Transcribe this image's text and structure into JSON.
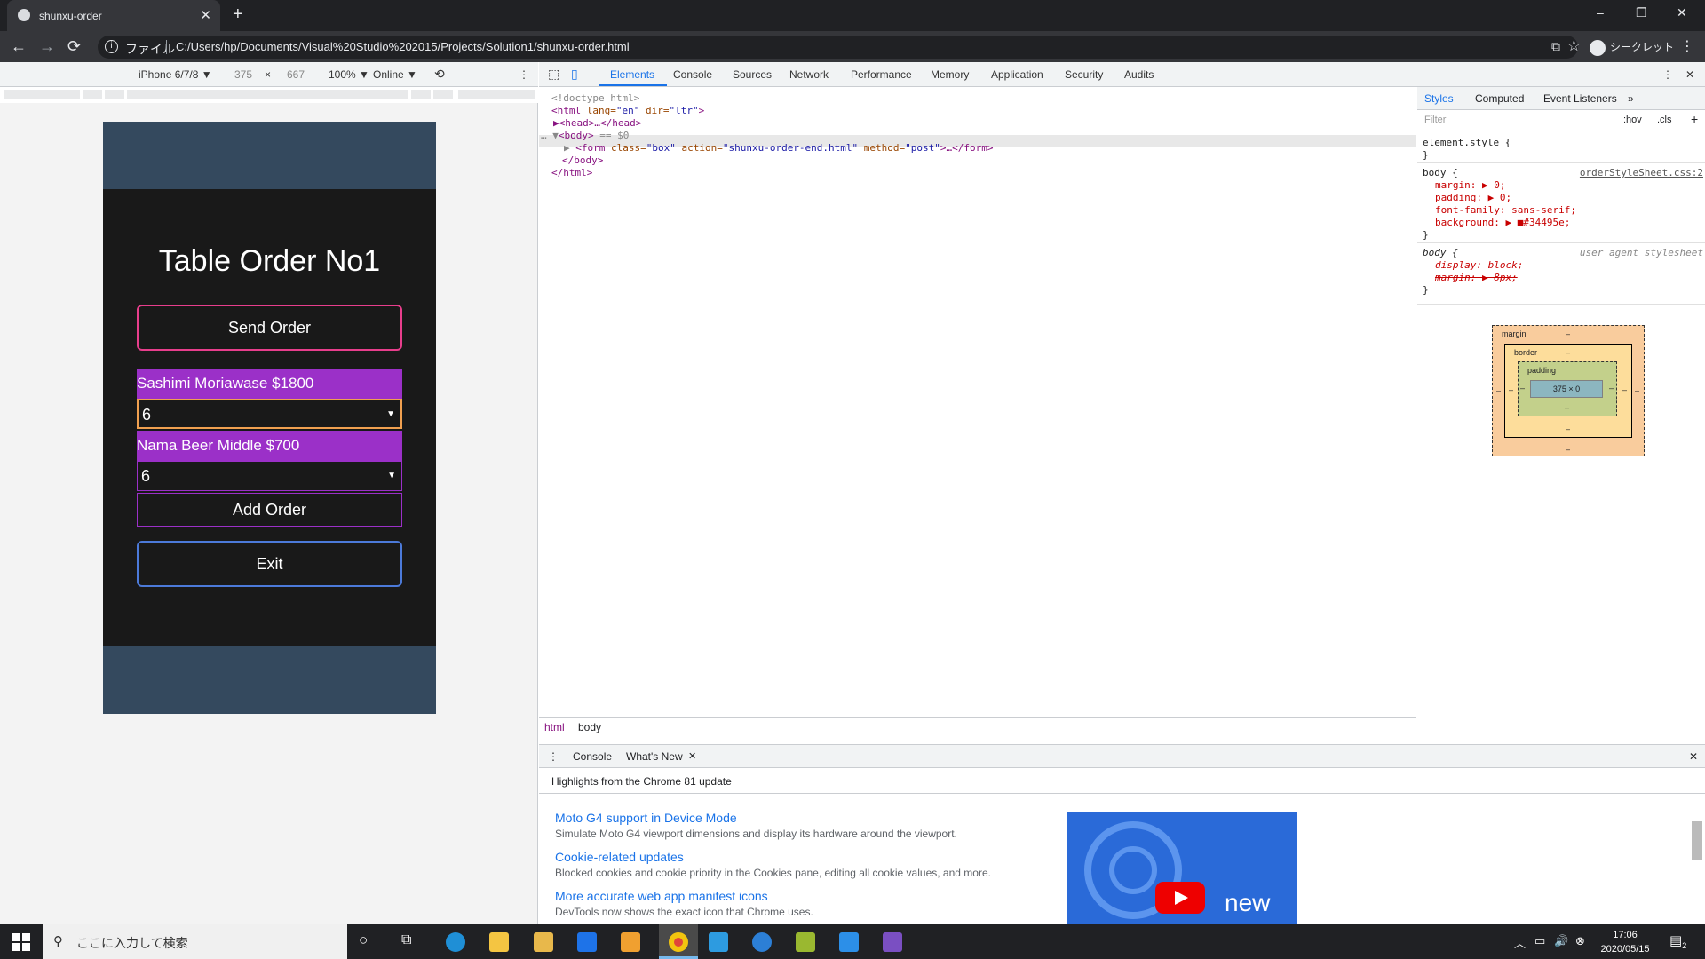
{
  "browser": {
    "tab_title": "shunxu-order",
    "new_tab": "+",
    "minimize": "–",
    "restore": "❐",
    "close": "✕",
    "back": "←",
    "forward": "→",
    "reload": "⟳",
    "info": "i",
    "file_label": "ファイル",
    "url": "C:/Users/hp/Documents/Visual%20Studio%202015/Projects/Solution1/shunxu-order.html",
    "translate": "⧉",
    "star": "☆",
    "incognito": "シークレット",
    "menu": "⋮"
  },
  "device_toolbar": {
    "device": "iPhone 6/7/8 ▼",
    "width": "375",
    "times": "×",
    "height": "667",
    "zoom": "100% ▼",
    "throttle": "Online ▼",
    "rotate": "⟲",
    "more": "⋮"
  },
  "page": {
    "title": "Table Order No1",
    "send_order": "Send Order",
    "item1_label": "Sashimi Moriawase $1800",
    "item1_qty": "6",
    "item2_label": "Nama Beer Middle $700",
    "item2_qty": "6",
    "add_order": "Add Order",
    "exit": "Exit",
    "arrow": "▼",
    "colors": {
      "background": "#34495e",
      "form": "#191919",
      "item": "#9b30c8",
      "send_border": "#e83e8c",
      "exit_border": "#4c7ad9"
    }
  },
  "devtools": {
    "inspect": "⬚",
    "device": "▯",
    "tabs": [
      "Elements",
      "Console",
      "Sources",
      "Network",
      "Performance",
      "Memory",
      "Application",
      "Security",
      "Audits"
    ],
    "kebab": "⋮",
    "close": "✕",
    "dom": {
      "doctype": "<!doctype html>",
      "html_open_tag": "<html",
      "lang_attr": " lang=",
      "lang_val": "\"en\"",
      "dir_attr": " dir=",
      "dir_val": "\"ltr\"",
      "gt": ">",
      "head": "▶<head>…</head>",
      "body_dots": "… ▼",
      "body_tag": "<body>",
      "body_eq": " == $0",
      "form_tri": "▶",
      "form_open": "<form",
      "class_attr": " class=",
      "class_val": "\"box\"",
      "action_attr": " action=",
      "action_val": "\"shunxu-order-end.html\"",
      "method_attr": " method=",
      "method_val": "\"post\"",
      "form_end": ">…</form>",
      "body_close": "</body>",
      "html_close": "</html>"
    },
    "breadcrumb": [
      "html",
      "body"
    ],
    "side_tabs": [
      "Styles",
      "Computed",
      "Event Listeners",
      "»"
    ],
    "filter_placeholder": "Filter",
    "hov": ":hov",
    "cls": ".cls",
    "plus": "+",
    "styles": {
      "element_style": "element.style {",
      "close_brace": "}",
      "body_rule": "body {",
      "body_source": "orderStyleSheet.css:2",
      "margin": "margin: ▶ 0;",
      "padding": "padding: ▶ 0;",
      "font_family": "font-family: sans-serif;",
      "background": "background: ▶ ■#34495e;",
      "ua_rule": "body {",
      "ua_source": "user agent stylesheet",
      "display": "display: block;",
      "margin_struck": "margin: ▶ 8px;"
    },
    "boxmodel": {
      "margin": "margin",
      "border": "border",
      "padding": "padding",
      "content": "375 × 0",
      "dash": "–"
    }
  },
  "drawer": {
    "kebab": "⋮",
    "tabs": [
      "Console",
      "What's New"
    ],
    "tab_close": "✕",
    "close": "✕",
    "highlight": "Highlights from the Chrome 81 update",
    "features": [
      {
        "title": "Moto G4 support in Device Mode",
        "desc": "Simulate Moto G4 viewport dimensions and display its hardware around the viewport."
      },
      {
        "title": "Cookie-related updates",
        "desc": "Blocked cookies and cookie priority in the Cookies pane, editing all cookie values, and more."
      },
      {
        "title": "More accurate web app manifest icons",
        "desc": "DevTools now shows the exact icon that Chrome uses."
      }
    ],
    "video_text": "new"
  },
  "taskbar": {
    "search": "ここに入力して検索",
    "search_icon": "⚲",
    "cortana": "○",
    "taskview": "⧉",
    "tray_up": "︿",
    "battery": "▭",
    "volume": "🔊",
    "network": "⊗",
    "time": "17:06",
    "date": "2020/05/15",
    "notif": "2",
    "notif_icon": "▤"
  }
}
